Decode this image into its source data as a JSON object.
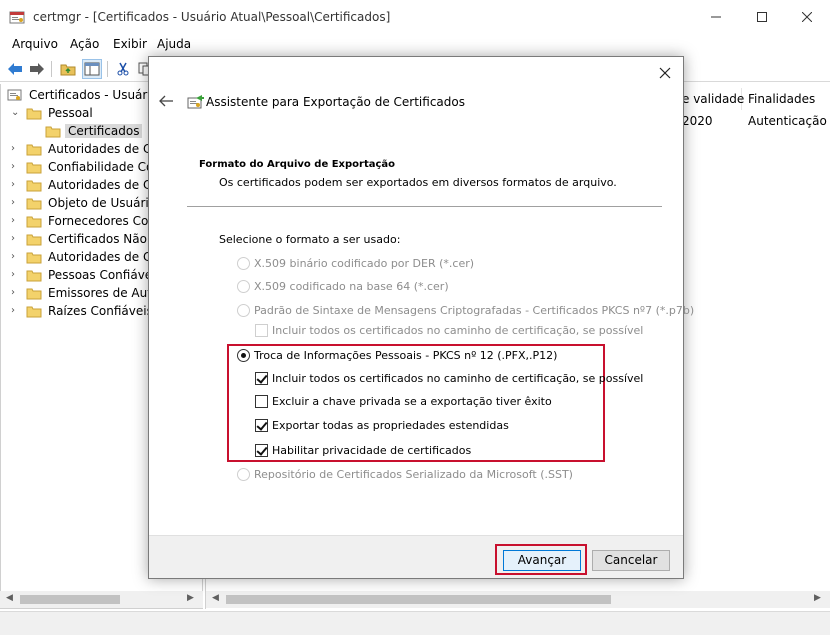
{
  "window": {
    "title": "certmgr - [Certificados - Usuário Atual\\Pessoal\\Certificados]",
    "controls": [
      "minimize",
      "maximize",
      "close"
    ]
  },
  "menubar": [
    "Arquivo",
    "Ação",
    "Exibir",
    "Ajuda"
  ],
  "toolbar": [
    "back-icon",
    "forward-icon",
    "folder-up-icon",
    "show-tree-icon",
    "cut-icon",
    "copy-icon"
  ],
  "tree": {
    "root": "Certificados - Usuário A",
    "personal": "Pessoal",
    "personal_child": "Certificados",
    "items": [
      "Autoridades de Cer",
      "Confiabilidade Corp",
      "Autoridades de Cer",
      "Objeto de Usuário c",
      "Fornecedores Conf",
      "Certificados Não C",
      "Autoridades de Cer",
      "Pessoas Confiáveis",
      "Emissores de Auter",
      "Raízes Confiáveis d"
    ]
  },
  "list": {
    "columns": [
      "e validade",
      "Finalidades"
    ],
    "rows": [
      [
        "2020",
        "Autenticação d"
      ]
    ]
  },
  "dialog": {
    "title": "Assistente para Exportação de Certificados",
    "section_title": "Formato do Arquivo de Exportação",
    "section_desc": "Os certificados podem ser exportados em diversos formatos de arquivo.",
    "prompt": "Selecione o formato a ser usado:",
    "options": {
      "der": "X.509 binário codificado por DER (*.cer)",
      "base64": "X.509 codificado na base 64 (*.cer)",
      "pkcs7": "Padrão de Sintaxe de Mensagens Criptografadas - Certificados PKCS nº7 (*.p7b)",
      "pkcs7_include": "Incluir todos os certificados no caminho de certificação, se possível",
      "pfx": "Troca de Informações Pessoais - PKCS nº 12 (.PFX,.P12)",
      "pfx_include": "Incluir todos os certificados no caminho de certificação, se possível",
      "pfx_delete_key": "Excluir a chave privada se a exportação tiver êxito",
      "pfx_export_props": "Exportar todas as propriedades estendidas",
      "pfx_privacy": "Habilitar privacidade de certificados",
      "sst": "Repositório de Certificados Serializado da Microsoft (.SST)"
    },
    "buttons": {
      "next": "Avançar",
      "cancel": "Cancelar"
    }
  },
  "colors": {
    "highlight": "#c8102e",
    "default_button_border": "#0078d7"
  }
}
